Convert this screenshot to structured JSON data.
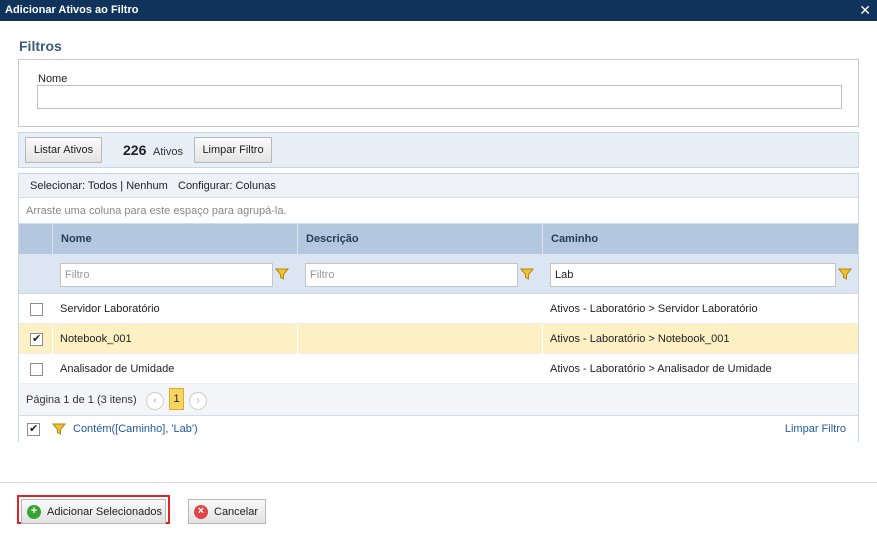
{
  "window": {
    "title": "Adicionar Ativos ao Filtro",
    "close_glyph": "✕"
  },
  "filters": {
    "section_title": "Filtros",
    "name_label": "Nome",
    "name_value": ""
  },
  "toolbar": {
    "list_button": "Listar Ativos",
    "count": "226",
    "count_label": "Ativos",
    "clear_button": "Limpar Filtro"
  },
  "grid": {
    "select_text": "Selecionar: Todos | Nenhum",
    "config_text": "Configurar: Colunas",
    "group_hint": "Arraste uma coluna para este espaço para agrupá-la.",
    "columns": [
      "Nome",
      "Descrição",
      "Caminho"
    ],
    "filter_placeholder": "Filtro",
    "filter_values": [
      "",
      "",
      "Lab"
    ],
    "rows": [
      {
        "checked": false,
        "nome": "Servidor Laboratório",
        "descricao": "",
        "caminho": "Ativos - Laboratório > Servidor Laboratório"
      },
      {
        "checked": true,
        "nome": "Notebook_001",
        "descricao": "",
        "caminho": "Ativos - Laboratório > Notebook_001"
      },
      {
        "checked": false,
        "nome": "Analisador de Umidade",
        "descricao": "",
        "caminho": "Ativos - Laboratório > Analisador de Umidade"
      }
    ],
    "pager": {
      "info": "Página 1 de 1 (3 itens)",
      "current_page": "1",
      "prev_glyph": "‹",
      "next_glyph": "›"
    },
    "filter_expression": "Contém([Caminho], 'Lab')",
    "filter_expression_enabled": true,
    "clear_filter_link": "Limpar Filtro"
  },
  "actions": {
    "add_selected": "Adicionar Selecionados",
    "cancel": "Cancelar",
    "add_icon": "+",
    "cancel_icon": "×"
  },
  "colors": {
    "titlebar": "#10335c",
    "header": "#b3c8df",
    "selected_row": "#fcf0c4",
    "highlight": "#e02424",
    "link": "#1f5aa3"
  }
}
